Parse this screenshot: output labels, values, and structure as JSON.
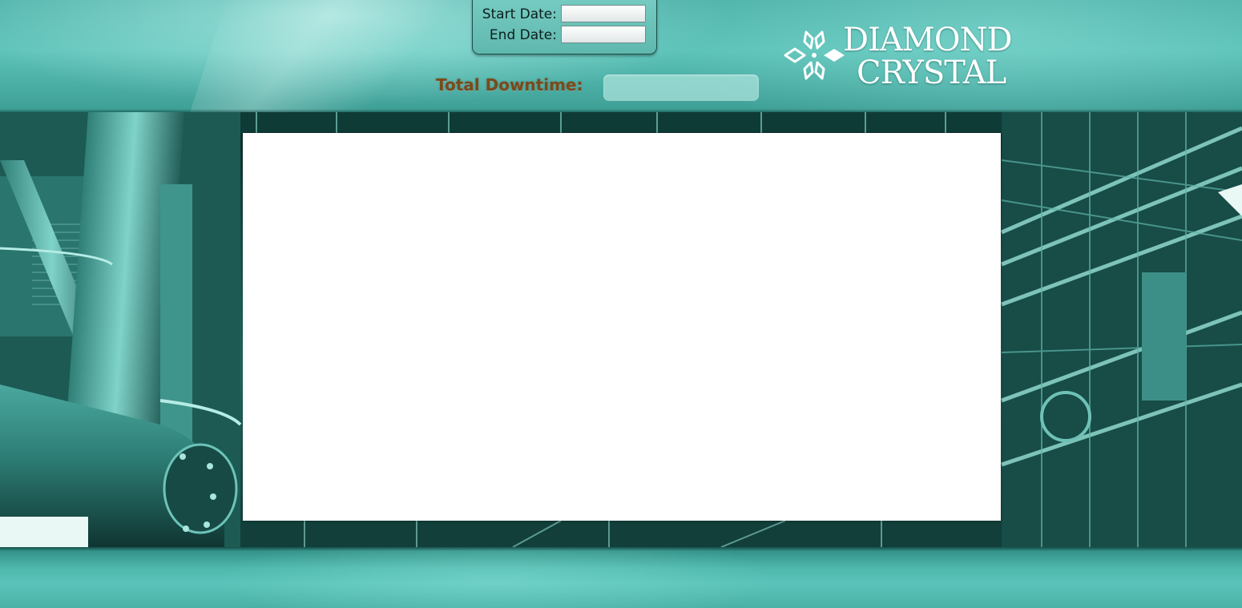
{
  "filters": {
    "start_date_label": "Start Date:",
    "end_date_label": "End Date:",
    "start_date_value": "",
    "end_date_value": ""
  },
  "downtime": {
    "label": "Total Downtime:",
    "value": ""
  },
  "logo": {
    "line1": "DIAMOND",
    "line2": "CRYSTAL",
    "icon": "snowflake-diamond-icon"
  },
  "colors": {
    "theme_teal": "#4fb5ab",
    "downtime_label": "#7a4a1c",
    "panel_background": "#ffffff"
  }
}
